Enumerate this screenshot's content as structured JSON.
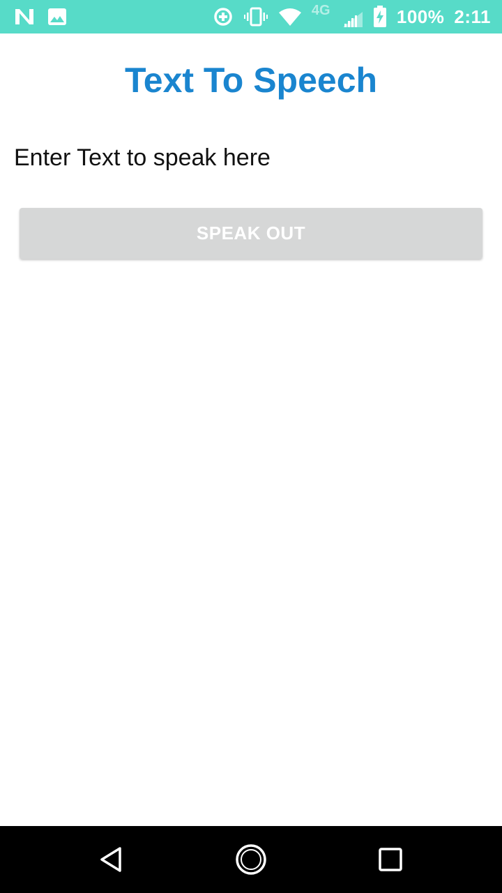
{
  "status_bar": {
    "background": "#57dbc8",
    "left_icons": [
      "n-logo-icon",
      "image-icon"
    ],
    "right_icons": [
      "data-saver-icon",
      "vibrate-icon",
      "wifi-icon",
      "lte-signal-icon",
      "battery-charging-icon"
    ],
    "network_label": "4G",
    "battery": "100%",
    "time": "2:11"
  },
  "app": {
    "title": "Text To Speech",
    "title_color": "#1a85cf",
    "input": {
      "value": "",
      "placeholder": "Enter Text to speak here"
    },
    "speak_button": {
      "label": "SPEAK OUT",
      "enabled": false,
      "color": "#d6d7d7"
    }
  },
  "nav_bar": {
    "buttons": [
      "back-icon",
      "home-icon",
      "recents-icon"
    ]
  }
}
